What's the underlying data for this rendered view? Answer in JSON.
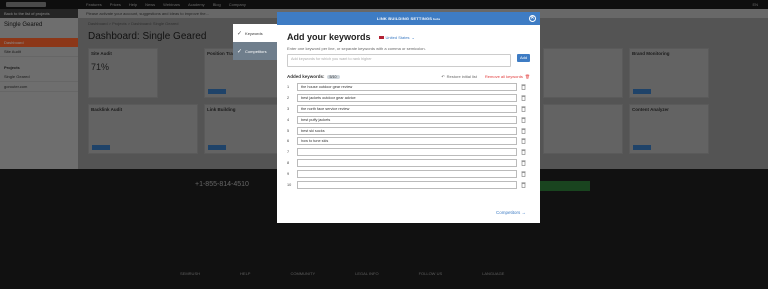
{
  "app": {
    "notice": "Please activate your account, suggestions and ideas to improve the...",
    "nav": [
      "Features",
      "Prices",
      "Help",
      "News",
      "Webinars",
      "Academy",
      "Blog",
      "Company"
    ],
    "lang": "EN"
  },
  "sidebar": {
    "back": "Back to the list of projects",
    "project": "Single Geared",
    "items": [
      "Dashboard",
      "Site Audit",
      "Projects"
    ],
    "sub": [
      "Single Geared",
      "gorouter.com"
    ]
  },
  "main": {
    "breadcrumb": "Dashboard > Projects > Dashboard: Single Geared",
    "title": "Dashboard: Single Geared",
    "site_audit_value": "71%",
    "cards": [
      "Site Audit",
      "Position Tracking",
      "Brand Monitoring",
      "Backlink Audit",
      "Link Building",
      "Content Analyzer"
    ]
  },
  "footer": {
    "phone": "+1-855-814-4510",
    "cols": [
      "SEMRUSH",
      "HELP",
      "COMMUNITY",
      "LEGAL INFO",
      "FOLLOW US",
      "LANGUAGE"
    ]
  },
  "wizard": {
    "tabs": [
      {
        "label": "Keywords",
        "active": false
      },
      {
        "label": "Competitors",
        "active": true
      }
    ]
  },
  "modal": {
    "header": "LINK BUILDING SETTINGS",
    "header_beta": "beta",
    "title": "Add your keywords",
    "country": "United States",
    "hint": "Enter one keyword per line, or separate keywords with a comma or semicolon.",
    "textarea_placeholder": "Add keywords for which you want to rank higher",
    "add_label": "Add",
    "added_label": "Added keywords:",
    "added_count": "5/10",
    "restore_label": "Restore initial list",
    "remove_label": "Remove all keywords",
    "keywords": [
      {
        "num": "1",
        "value": "the house outdoor gear review"
      },
      {
        "num": "2",
        "value": "best jackets outdoor gear advice"
      },
      {
        "num": "3",
        "value": "the north face service review"
      },
      {
        "num": "4",
        "value": "best puffy jackets"
      },
      {
        "num": "5",
        "value": "best ski socks"
      },
      {
        "num": "6",
        "value": "how to tune skis"
      },
      {
        "num": "7",
        "value": ""
      },
      {
        "num": "8",
        "value": ""
      },
      {
        "num": "9",
        "value": ""
      },
      {
        "num": "10",
        "value": ""
      }
    ],
    "next_label": "Competitors →",
    "accent": "#3e7cc4",
    "danger": "#e23b3b"
  }
}
